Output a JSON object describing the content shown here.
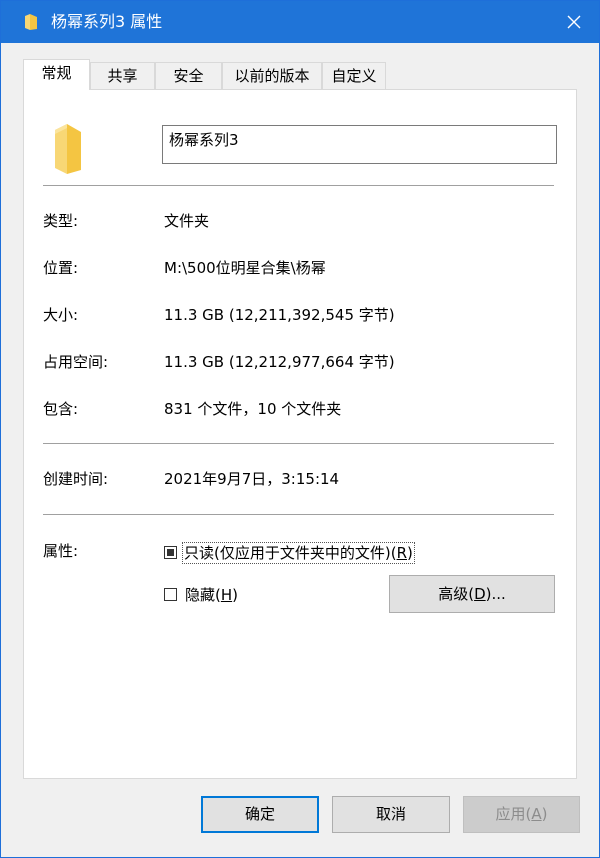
{
  "window": {
    "title": "杨幂系列3 属性"
  },
  "tabs": [
    {
      "label": "常规"
    },
    {
      "label": "共享"
    },
    {
      "label": "安全"
    },
    {
      "label": "以前的版本"
    },
    {
      "label": "自定义"
    }
  ],
  "general": {
    "folder_name": "杨幂系列3",
    "type_label": "类型:",
    "type_value": "文件夹",
    "location_label": "位置:",
    "location_value": "M:\\500位明星合集\\杨幂",
    "size_label": "大小:",
    "size_value": "11.3 GB (12,211,392,545 字节)",
    "size_on_disk_label": "占用空间:",
    "size_on_disk_value": "11.3 GB (12,212,977,664 字节)",
    "contains_label": "包含:",
    "contains_value": "831 个文件，10 个文件夹",
    "created_label": "创建时间:",
    "created_value": "2021年9月7日，3:15:14",
    "attributes_label": "属性:",
    "readonly_text": "只读(仅应用于文件夹中的文件)(",
    "readonly_key": "R",
    "readonly_close": ")",
    "hidden_text": "隐藏(",
    "hidden_key": "H",
    "hidden_close": ")",
    "advanced_text": "高级(",
    "advanced_key": "D",
    "advanced_close": ")..."
  },
  "buttons": {
    "ok": "确定",
    "cancel": "取消",
    "apply_text": "应用(",
    "apply_key": "A",
    "apply_close": ")"
  },
  "colors": {
    "titlebar": "#1f74d8",
    "folder": "#f8d775",
    "focus_border": "#0078d7"
  }
}
